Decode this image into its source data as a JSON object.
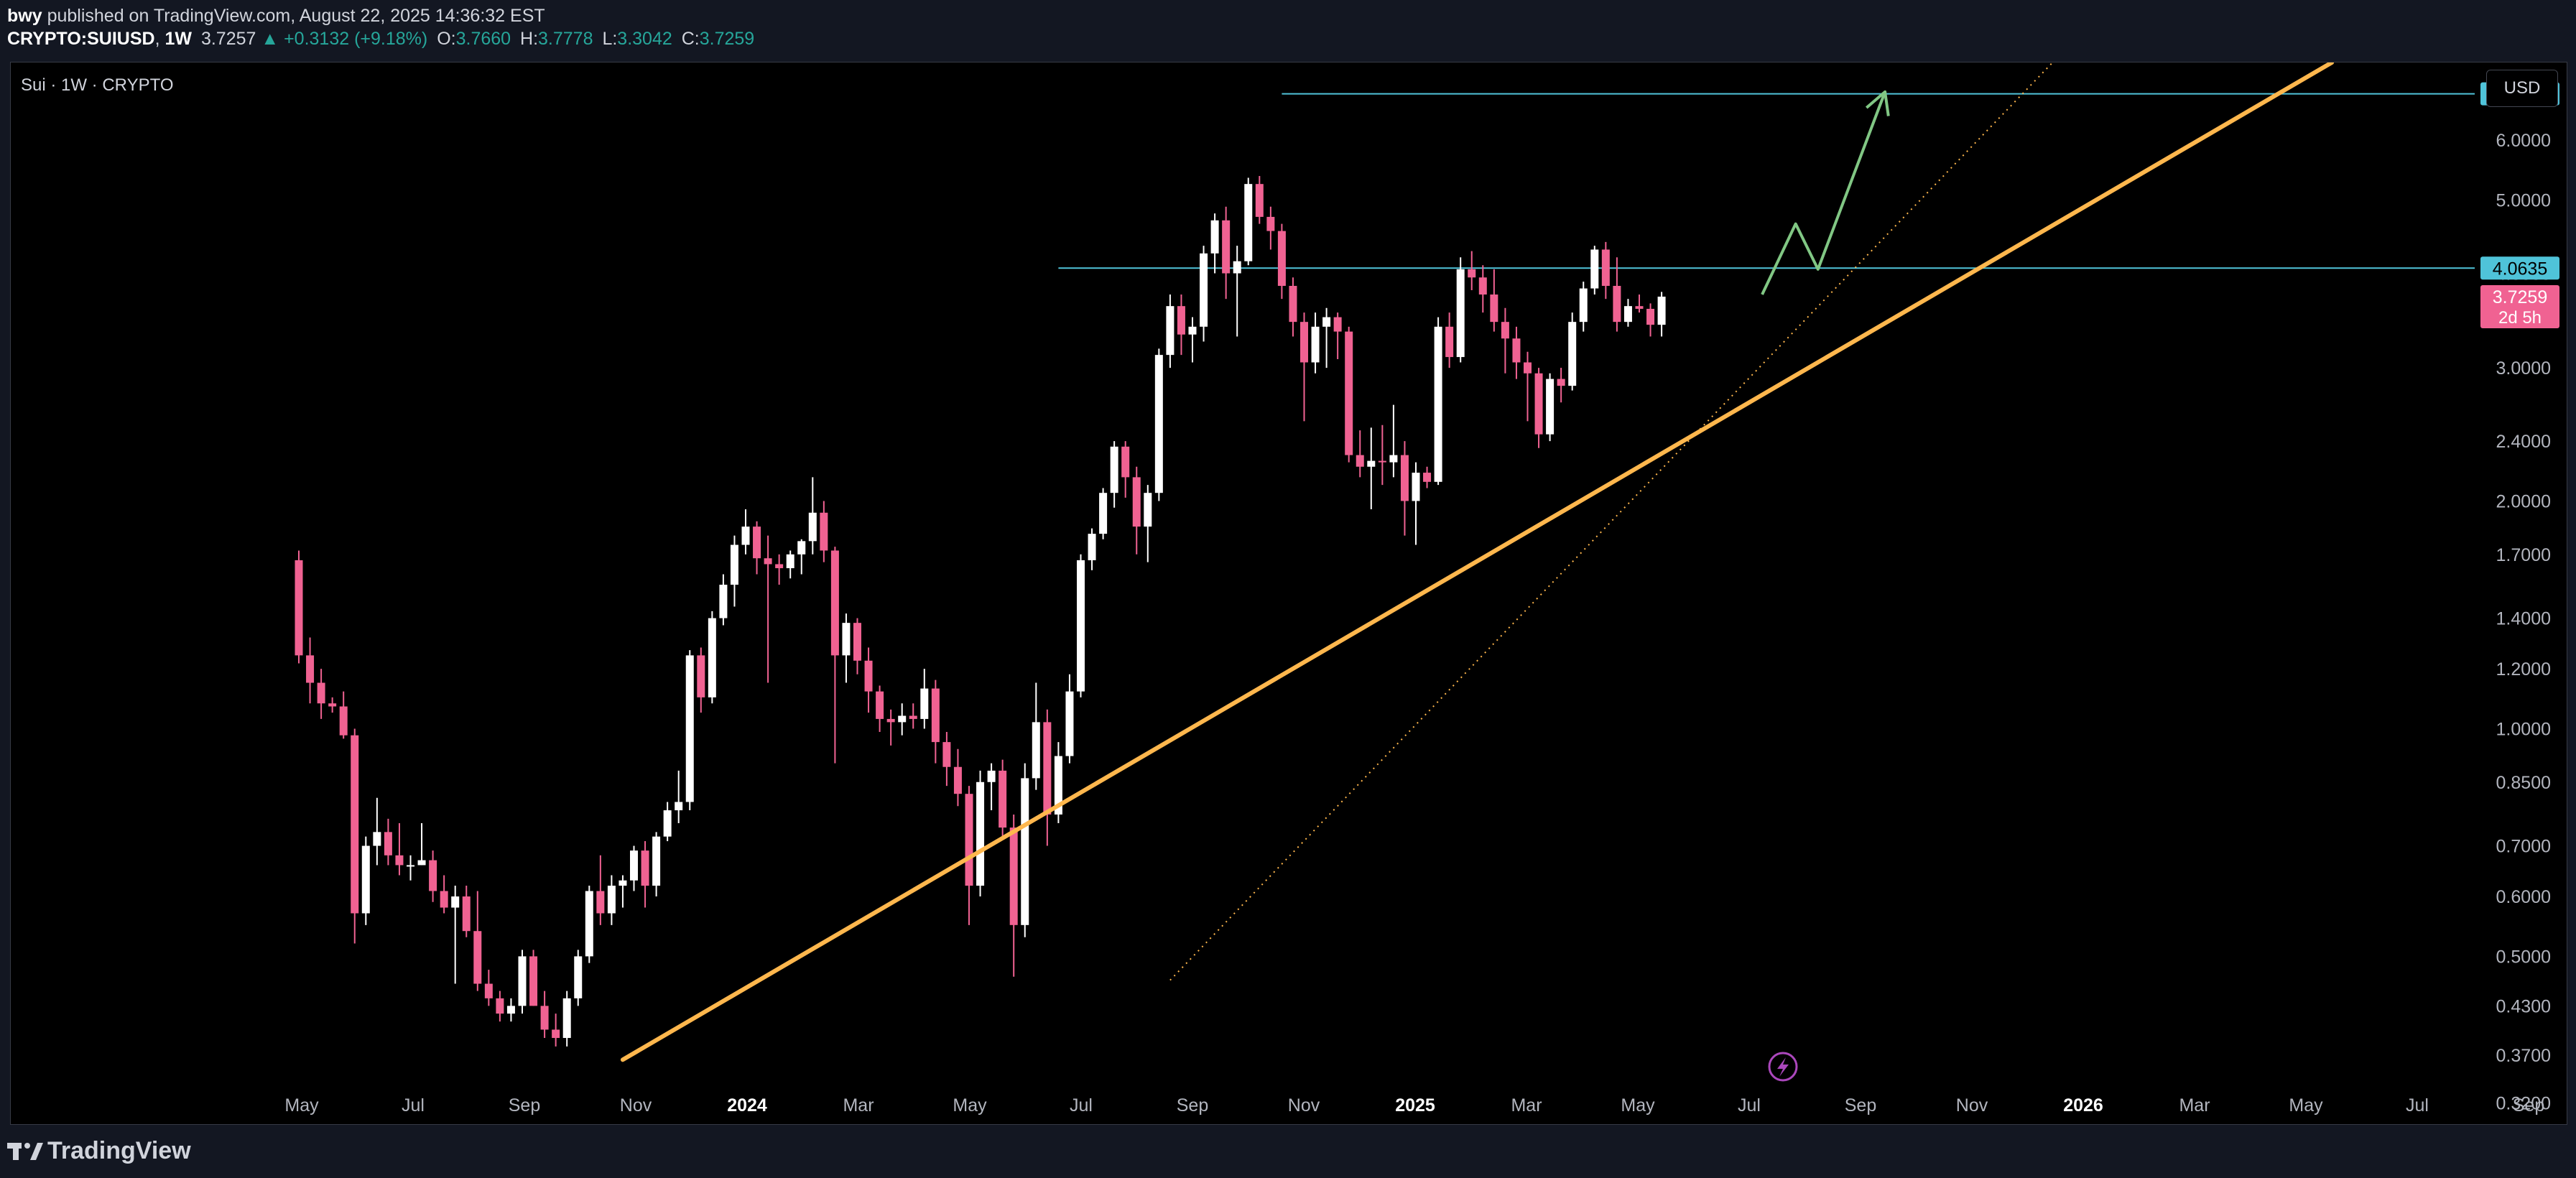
{
  "header": {
    "author": "bwy",
    "published_text": "published on TradingView.com, August 22, 2025 14:36:32 EST",
    "symbol": "CRYPTO:SUIUSD",
    "interval": "1W",
    "last": "3.7257",
    "change_arrow": "▲",
    "change": "+0.3132 (+9.18%)",
    "o_label": "O:",
    "o_value": "3.7660",
    "h_label": "H:",
    "h_value": "3.7778",
    "l_label": "L:",
    "l_value": "3.3042",
    "c_label": "C:",
    "c_value": "3.7259"
  },
  "chart_header": {
    "legend": "Sui · 1W · CRYPTO",
    "currency": "USD"
  },
  "footer": {
    "brand": "TradingView"
  },
  "chart_data": {
    "type": "candlestick",
    "scale": "log",
    "interval": "1W",
    "grid": false,
    "ylim": [
      0.3,
      7.6
    ],
    "x_tick_labels": [
      "May",
      "Jul",
      "Sep",
      "Nov",
      "2024",
      "Mar",
      "May",
      "Jul",
      "Sep",
      "Nov",
      "2025",
      "Mar",
      "May",
      "Jul",
      "Sep",
      "Nov",
      "2026",
      "Mar",
      "May",
      "Jul",
      "Sep"
    ],
    "x_tick_bold": [
      "2024",
      "2025",
      "2026"
    ],
    "y_tick_labels": [
      "6.0000",
      "5.0000",
      "4.0000",
      "3.0000",
      "2.4000",
      "2.0000",
      "1.7000",
      "1.4000",
      "1.2000",
      "1.0000",
      "0.8500",
      "0.7000",
      "0.6000",
      "0.5000",
      "0.4300",
      "0.3700",
      "0.3200"
    ],
    "price_markers": [
      {
        "label": "6.9080",
        "value": 6.908,
        "bg": "#4fc3d9",
        "fg": "#000000"
      },
      {
        "label": "4.0635",
        "value": 4.0635,
        "bg": "#4fc3d9",
        "fg": "#000000"
      },
      {
        "label": "3.7259",
        "value": 3.7259,
        "bg": "#f06292",
        "fg": "#ffffff",
        "sub": "2d 5h"
      }
    ],
    "horizontal_levels": [
      {
        "value": 6.908,
        "from_week": 88,
        "color": "#4fc3d9"
      },
      {
        "value": 4.0635,
        "from_week": 68,
        "color": "#4fc3d9"
      }
    ],
    "trendlines": [
      {
        "name": "main-support",
        "from": [
          29,
          0.365
        ],
        "to": [
          182,
          7.6
        ],
        "color": "#ffb74d",
        "style": "solid"
      },
      {
        "name": "steep-support",
        "from": [
          78,
          0.465
        ],
        "to": [
          157,
          7.6
        ],
        "color": "#ffb74d",
        "style": "dotted"
      }
    ],
    "projection_path": [
      [
        131,
        3.75
      ],
      [
        134,
        4.65
      ],
      [
        136,
        4.05
      ],
      [
        142,
        6.95
      ]
    ],
    "projection_color": "#81c784",
    "candles": [
      {
        "o": 1.67,
        "h": 1.72,
        "l": 1.22,
        "c": 1.25
      },
      {
        "o": 1.25,
        "h": 1.32,
        "l": 1.08,
        "c": 1.15
      },
      {
        "o": 1.15,
        "h": 1.2,
        "l": 1.03,
        "c": 1.08
      },
      {
        "o": 1.08,
        "h": 1.1,
        "l": 1.05,
        "c": 1.07
      },
      {
        "o": 1.07,
        "h": 1.12,
        "l": 0.97,
        "c": 0.98
      },
      {
        "o": 0.98,
        "h": 1.0,
        "l": 0.52,
        "c": 0.57
      },
      {
        "o": 0.57,
        "h": 0.72,
        "l": 0.55,
        "c": 0.7
      },
      {
        "o": 0.7,
        "h": 0.81,
        "l": 0.66,
        "c": 0.73
      },
      {
        "o": 0.73,
        "h": 0.76,
        "l": 0.66,
        "c": 0.68
      },
      {
        "o": 0.68,
        "h": 0.75,
        "l": 0.64,
        "c": 0.66
      },
      {
        "o": 0.66,
        "h": 0.68,
        "l": 0.63,
        "c": 0.66
      },
      {
        "o": 0.66,
        "h": 0.75,
        "l": 0.66,
        "c": 0.67
      },
      {
        "o": 0.67,
        "h": 0.69,
        "l": 0.59,
        "c": 0.61
      },
      {
        "o": 0.61,
        "h": 0.64,
        "l": 0.57,
        "c": 0.58
      },
      {
        "o": 0.58,
        "h": 0.62,
        "l": 0.46,
        "c": 0.6
      },
      {
        "o": 0.6,
        "h": 0.62,
        "l": 0.53,
        "c": 0.54
      },
      {
        "o": 0.54,
        "h": 0.61,
        "l": 0.45,
        "c": 0.46
      },
      {
        "o": 0.46,
        "h": 0.48,
        "l": 0.43,
        "c": 0.44
      },
      {
        "o": 0.44,
        "h": 0.45,
        "l": 0.41,
        "c": 0.42
      },
      {
        "o": 0.42,
        "h": 0.44,
        "l": 0.41,
        "c": 0.43
      },
      {
        "o": 0.43,
        "h": 0.51,
        "l": 0.42,
        "c": 0.5
      },
      {
        "o": 0.5,
        "h": 0.51,
        "l": 0.43,
        "c": 0.43
      },
      {
        "o": 0.43,
        "h": 0.45,
        "l": 0.39,
        "c": 0.4
      },
      {
        "o": 0.4,
        "h": 0.42,
        "l": 0.38,
        "c": 0.39
      },
      {
        "o": 0.39,
        "h": 0.45,
        "l": 0.38,
        "c": 0.44
      },
      {
        "o": 0.44,
        "h": 0.51,
        "l": 0.43,
        "c": 0.5
      },
      {
        "o": 0.5,
        "h": 0.62,
        "l": 0.49,
        "c": 0.61
      },
      {
        "o": 0.61,
        "h": 0.68,
        "l": 0.55,
        "c": 0.57
      },
      {
        "o": 0.57,
        "h": 0.64,
        "l": 0.55,
        "c": 0.62
      },
      {
        "o": 0.62,
        "h": 0.64,
        "l": 0.58,
        "c": 0.63
      },
      {
        "o": 0.63,
        "h": 0.7,
        "l": 0.61,
        "c": 0.69
      },
      {
        "o": 0.69,
        "h": 0.71,
        "l": 0.58,
        "c": 0.62
      },
      {
        "o": 0.62,
        "h": 0.73,
        "l": 0.6,
        "c": 0.72
      },
      {
        "o": 0.72,
        "h": 0.8,
        "l": 0.71,
        "c": 0.78
      },
      {
        "o": 0.78,
        "h": 0.88,
        "l": 0.75,
        "c": 0.8
      },
      {
        "o": 0.8,
        "h": 1.27,
        "l": 0.78,
        "c": 1.25
      },
      {
        "o": 1.25,
        "h": 1.28,
        "l": 1.05,
        "c": 1.1
      },
      {
        "o": 1.1,
        "h": 1.43,
        "l": 1.08,
        "c": 1.4
      },
      {
        "o": 1.4,
        "h": 1.6,
        "l": 1.37,
        "c": 1.55
      },
      {
        "o": 1.55,
        "h": 1.8,
        "l": 1.45,
        "c": 1.75
      },
      {
        "o": 1.75,
        "h": 1.95,
        "l": 1.7,
        "c": 1.85
      },
      {
        "o": 1.85,
        "h": 1.88,
        "l": 1.6,
        "c": 1.68
      },
      {
        "o": 1.68,
        "h": 1.8,
        "l": 1.15,
        "c": 1.65
      },
      {
        "o": 1.65,
        "h": 1.7,
        "l": 1.55,
        "c": 1.63
      },
      {
        "o": 1.63,
        "h": 1.72,
        "l": 1.58,
        "c": 1.7
      },
      {
        "o": 1.7,
        "h": 1.78,
        "l": 1.6,
        "c": 1.77
      },
      {
        "o": 1.77,
        "h": 2.15,
        "l": 1.7,
        "c": 1.93
      },
      {
        "o": 1.93,
        "h": 2.0,
        "l": 1.66,
        "c": 1.72
      },
      {
        "o": 1.72,
        "h": 1.74,
        "l": 0.9,
        "c": 1.25
      },
      {
        "o": 1.25,
        "h": 1.42,
        "l": 1.15,
        "c": 1.38
      },
      {
        "o": 1.38,
        "h": 1.4,
        "l": 1.18,
        "c": 1.23
      },
      {
        "o": 1.23,
        "h": 1.28,
        "l": 1.05,
        "c": 1.12
      },
      {
        "o": 1.12,
        "h": 1.14,
        "l": 0.99,
        "c": 1.03
      },
      {
        "o": 1.03,
        "h": 1.06,
        "l": 0.95,
        "c": 1.02
      },
      {
        "o": 1.02,
        "h": 1.08,
        "l": 0.98,
        "c": 1.04
      },
      {
        "o": 1.04,
        "h": 1.08,
        "l": 1.0,
        "c": 1.03
      },
      {
        "o": 1.03,
        "h": 1.2,
        "l": 1.0,
        "c": 1.13
      },
      {
        "o": 1.13,
        "h": 1.16,
        "l": 0.9,
        "c": 0.96
      },
      {
        "o": 0.96,
        "h": 0.99,
        "l": 0.84,
        "c": 0.89
      },
      {
        "o": 0.89,
        "h": 0.94,
        "l": 0.79,
        "c": 0.82
      },
      {
        "o": 0.82,
        "h": 0.84,
        "l": 0.55,
        "c": 0.62
      },
      {
        "o": 0.62,
        "h": 0.88,
        "l": 0.6,
        "c": 0.85
      },
      {
        "o": 0.85,
        "h": 0.9,
        "l": 0.78,
        "c": 0.88
      },
      {
        "o": 0.88,
        "h": 0.91,
        "l": 0.72,
        "c": 0.74
      },
      {
        "o": 0.74,
        "h": 0.77,
        "l": 0.47,
        "c": 0.55
      },
      {
        "o": 0.55,
        "h": 0.9,
        "l": 0.53,
        "c": 0.86
      },
      {
        "o": 0.86,
        "h": 1.15,
        "l": 0.83,
        "c": 1.02
      },
      {
        "o": 1.02,
        "h": 1.06,
        "l": 0.7,
        "c": 0.77
      },
      {
        "o": 0.77,
        "h": 0.96,
        "l": 0.75,
        "c": 0.92
      },
      {
        "o": 0.92,
        "h": 1.18,
        "l": 0.9,
        "c": 1.12
      },
      {
        "o": 1.12,
        "h": 1.7,
        "l": 1.1,
        "c": 1.67
      },
      {
        "o": 1.67,
        "h": 1.84,
        "l": 1.62,
        "c": 1.81
      },
      {
        "o": 1.81,
        "h": 2.08,
        "l": 1.78,
        "c": 2.05
      },
      {
        "o": 2.05,
        "h": 2.4,
        "l": 1.96,
        "c": 2.36
      },
      {
        "o": 2.36,
        "h": 2.4,
        "l": 2.02,
        "c": 2.15
      },
      {
        "o": 2.15,
        "h": 2.22,
        "l": 1.7,
        "c": 1.85
      },
      {
        "o": 1.85,
        "h": 2.1,
        "l": 1.66,
        "c": 2.05
      },
      {
        "o": 2.05,
        "h": 3.18,
        "l": 2.0,
        "c": 3.12
      },
      {
        "o": 3.12,
        "h": 3.75,
        "l": 3.0,
        "c": 3.62
      },
      {
        "o": 3.62,
        "h": 3.75,
        "l": 3.12,
        "c": 3.32
      },
      {
        "o": 3.32,
        "h": 3.5,
        "l": 3.05,
        "c": 3.4
      },
      {
        "o": 3.4,
        "h": 4.35,
        "l": 3.25,
        "c": 4.25
      },
      {
        "o": 4.25,
        "h": 4.8,
        "l": 4.0,
        "c": 4.7
      },
      {
        "o": 4.7,
        "h": 4.9,
        "l": 3.7,
        "c": 4.0
      },
      {
        "o": 4.0,
        "h": 4.35,
        "l": 3.3,
        "c": 4.15
      },
      {
        "o": 4.15,
        "h": 5.35,
        "l": 4.1,
        "c": 5.25
      },
      {
        "o": 5.25,
        "h": 5.38,
        "l": 4.65,
        "c": 4.75
      },
      {
        "o": 4.75,
        "h": 4.9,
        "l": 4.3,
        "c": 4.55
      },
      {
        "o": 4.55,
        "h": 4.65,
        "l": 3.7,
        "c": 3.85
      },
      {
        "o": 3.85,
        "h": 3.95,
        "l": 3.3,
        "c": 3.45
      },
      {
        "o": 3.45,
        "h": 3.55,
        "l": 2.55,
        "c": 3.05
      },
      {
        "o": 3.05,
        "h": 3.55,
        "l": 2.95,
        "c": 3.4
      },
      {
        "o": 3.4,
        "h": 3.6,
        "l": 3.0,
        "c": 3.5
      },
      {
        "o": 3.5,
        "h": 3.55,
        "l": 3.08,
        "c": 3.35
      },
      {
        "o": 3.35,
        "h": 3.4,
        "l": 2.25,
        "c": 2.3
      },
      {
        "o": 2.3,
        "h": 2.48,
        "l": 2.15,
        "c": 2.22
      },
      {
        "o": 2.22,
        "h": 2.5,
        "l": 1.95,
        "c": 2.26
      },
      {
        "o": 2.26,
        "h": 2.52,
        "l": 2.1,
        "c": 2.25
      },
      {
        "o": 2.25,
        "h": 2.68,
        "l": 2.15,
        "c": 2.3
      },
      {
        "o": 2.3,
        "h": 2.4,
        "l": 1.8,
        "c": 2.0
      },
      {
        "o": 2.0,
        "h": 2.25,
        "l": 1.75,
        "c": 2.18
      },
      {
        "o": 2.18,
        "h": 2.22,
        "l": 2.08,
        "c": 2.12
      },
      {
        "o": 2.12,
        "h": 3.5,
        "l": 2.1,
        "c": 3.4
      },
      {
        "o": 3.4,
        "h": 3.55,
        "l": 3.0,
        "c": 3.1
      },
      {
        "o": 3.1,
        "h": 4.2,
        "l": 3.05,
        "c": 4.05
      },
      {
        "o": 4.05,
        "h": 4.28,
        "l": 3.8,
        "c": 3.95
      },
      {
        "o": 3.95,
        "h": 4.1,
        "l": 3.55,
        "c": 3.75
      },
      {
        "o": 3.75,
        "h": 4.05,
        "l": 3.35,
        "c": 3.45
      },
      {
        "o": 3.45,
        "h": 3.6,
        "l": 2.95,
        "c": 3.28
      },
      {
        "o": 3.28,
        "h": 3.4,
        "l": 2.9,
        "c": 3.05
      },
      {
        "o": 3.05,
        "h": 3.15,
        "l": 2.55,
        "c": 2.95
      },
      {
        "o": 2.95,
        "h": 3.0,
        "l": 2.35,
        "c": 2.45
      },
      {
        "o": 2.45,
        "h": 2.95,
        "l": 2.4,
        "c": 2.9
      },
      {
        "o": 2.9,
        "h": 3.0,
        "l": 2.7,
        "c": 2.84
      },
      {
        "o": 2.84,
        "h": 3.55,
        "l": 2.8,
        "c": 3.45
      },
      {
        "o": 3.45,
        "h": 3.9,
        "l": 3.35,
        "c": 3.82
      },
      {
        "o": 3.82,
        "h": 4.35,
        "l": 3.75,
        "c": 4.3
      },
      {
        "o": 4.3,
        "h": 4.4,
        "l": 3.7,
        "c": 3.85
      },
      {
        "o": 3.85,
        "h": 4.2,
        "l": 3.35,
        "c": 3.45
      },
      {
        "o": 3.45,
        "h": 3.7,
        "l": 3.4,
        "c": 3.62
      },
      {
        "o": 3.62,
        "h": 3.75,
        "l": 3.55,
        "c": 3.59
      },
      {
        "o": 3.59,
        "h": 3.65,
        "l": 3.3,
        "c": 3.42
      },
      {
        "o": 3.42,
        "h": 3.78,
        "l": 3.3,
        "c": 3.7259
      }
    ]
  }
}
